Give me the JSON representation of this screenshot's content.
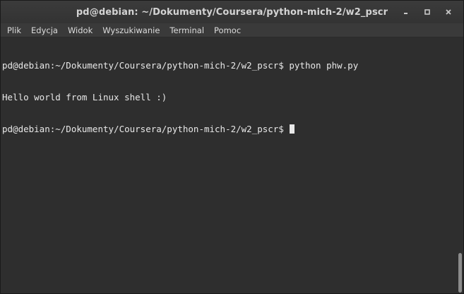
{
  "window": {
    "title": "pd@debian: ~/Dokumenty/Coursera/python-mich-2/w2_pscr"
  },
  "wm": {
    "minimize_icon": "minimize-icon",
    "maximize_icon": "maximize-icon",
    "close_icon": "close-icon"
  },
  "menu": {
    "items": [
      "Plik",
      "Edycja",
      "Widok",
      "Wyszukiwanie",
      "Terminal",
      "Pomoc"
    ]
  },
  "terminal": {
    "lines": [
      "pd@debian:~/Dokumenty/Coursera/python-mich-2/w2_pscr$ python phw.py",
      "Hello world from Linux shell :)",
      "pd@debian:~/Dokumenty/Coursera/python-mich-2/w2_pscr$ "
    ]
  },
  "colors": {
    "background": "#2e2e2e",
    "foreground": "#e8e8e8",
    "titlebar": "#363636",
    "menubar": "#3a3a3a"
  }
}
